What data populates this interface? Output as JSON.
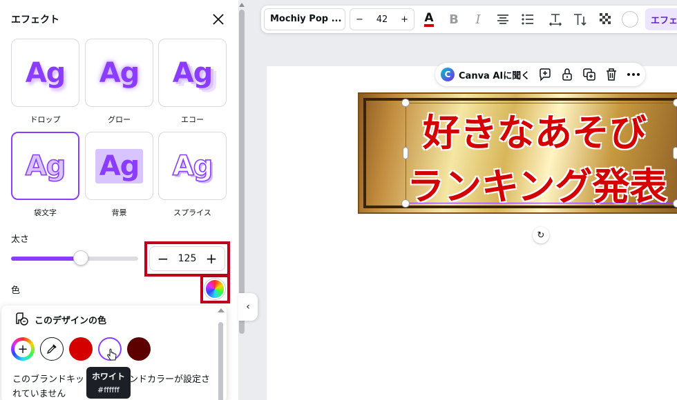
{
  "panel": {
    "title": "エフェクト",
    "effects": [
      {
        "label": "ドロップ",
        "preview": "Ag"
      },
      {
        "label": "グロー",
        "preview": "Ag"
      },
      {
        "label": "エコー",
        "preview": "Ag"
      },
      {
        "label": "袋文字",
        "preview": "Ag"
      },
      {
        "label": "背景",
        "preview": "Ag"
      },
      {
        "label": "スプライス",
        "preview": "Ag"
      }
    ],
    "selected_effect": "袋文字",
    "thickness_label": "太さ",
    "thickness_value": "125",
    "thickness_fraction": 0.55,
    "color_label": "色",
    "accent_color": "#8b3dff",
    "highlight_color": "#c0001b"
  },
  "popover": {
    "title": "このデザインの色",
    "colors": [
      "#d40000",
      "#ffffff",
      "#5c0000"
    ],
    "message": "このブランドキットにはブランドカラーが設定されていません",
    "tooltip": {
      "name": "ホワイト",
      "hex": "#ffffff"
    }
  },
  "toolbar": {
    "font": "Mochiy Pop ...",
    "font_size": "42",
    "effect_button": "エフェクト"
  },
  "context_bar": {
    "ai_label": "Canva AIに聞く"
  },
  "canvas": {
    "line1": "好きなあそび",
    "line2": "ランキング発表",
    "text_color": "#d40000"
  }
}
